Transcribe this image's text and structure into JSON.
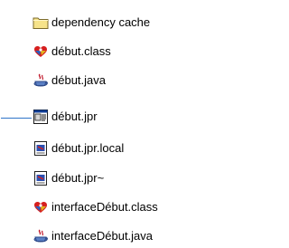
{
  "file_list": {
    "items": [
      {
        "label": "dependency cache",
        "icon": "folder-icon"
      },
      {
        "label": "début.class",
        "icon": "java-class-icon"
      },
      {
        "label": "début.java",
        "icon": "java-source-icon"
      },
      {
        "label": "début.jpr",
        "icon": "project-window-icon"
      },
      {
        "label": "début.jpr.local",
        "icon": "document-icon"
      },
      {
        "label": "début.jpr~",
        "icon": "document-icon"
      },
      {
        "label": "interfaceDébut.class",
        "icon": "java-class-icon"
      },
      {
        "label": "interfaceDébut.java",
        "icon": "java-source-icon"
      }
    ]
  },
  "colors": {
    "folder": "#f6e38a",
    "connector": "#2f74c9",
    "java_class_red": "#d61f1f",
    "java_class_blue": "#2a5fbf",
    "java_source_steam": "#c21d2f"
  }
}
